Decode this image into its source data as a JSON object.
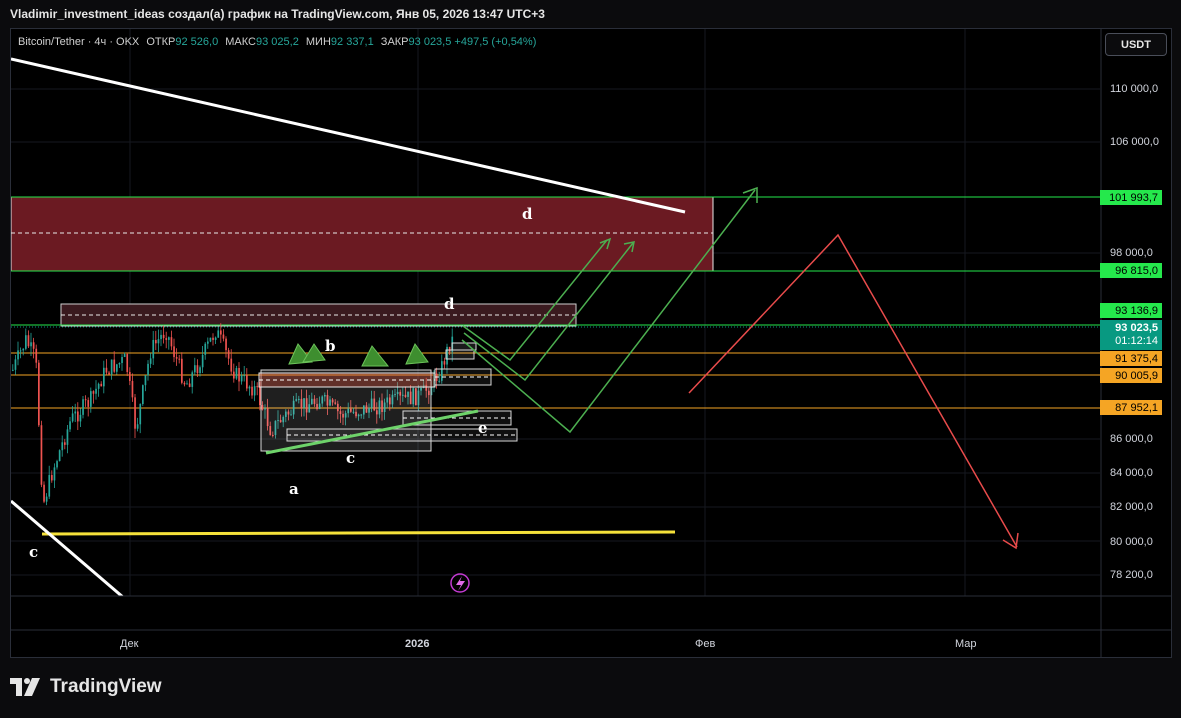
{
  "header": {
    "caption": "Vladimir_investment_ideas создал(а) график на TradingView.com, Янв 05, 2026 13:47 UTC+3"
  },
  "legend": {
    "symbol": "Bitcoin/Tether · 4ч · OKX",
    "open_label": "ОТКР",
    "open_value": "92 526,0",
    "high_label": "МАКС",
    "high_value": "93 025,2",
    "low_label": "МИН",
    "low_value": "92 337,1",
    "close_label": "ЗАКР",
    "close_value": "93 023,5",
    "change": "+497,5 (+0,54%)"
  },
  "currency_button": "USDT",
  "price_axis": {
    "labels": [
      "110 000,0",
      "106 000,0",
      "98 000,0",
      "86 000,0",
      "84 000,0",
      "82 000,0",
      "80 000,0",
      "78 200,0"
    ],
    "tags": {
      "r1": "101 993,7",
      "r2": "96 815,0",
      "r3": "93 136,9",
      "current_price": "93 023,5",
      "countdown": "01:12:14",
      "s1": "91 375,4",
      "s2": "90 005,9",
      "s3": "87 952,1"
    }
  },
  "time_axis": {
    "dec": "Дек",
    "year": "2026",
    "feb": "Фев",
    "mar": "Мар"
  },
  "annotations": {
    "a": "a",
    "b": "b",
    "c_mid": "c",
    "c_left": "c",
    "d_top": "d",
    "d_mid": "d",
    "e": "e"
  },
  "colors": {
    "background": "#000000",
    "bull": "#26a69a",
    "bear": "#ef5350",
    "resistance_zone": "#6b1a22",
    "green_line": "#25e84c",
    "orange_line": "#f5a524",
    "yellow_line": "#f5e13a",
    "forecast_green": "#4caf50",
    "forecast_red": "#e84b4b"
  },
  "footer": {
    "brand": "TradingView"
  }
}
